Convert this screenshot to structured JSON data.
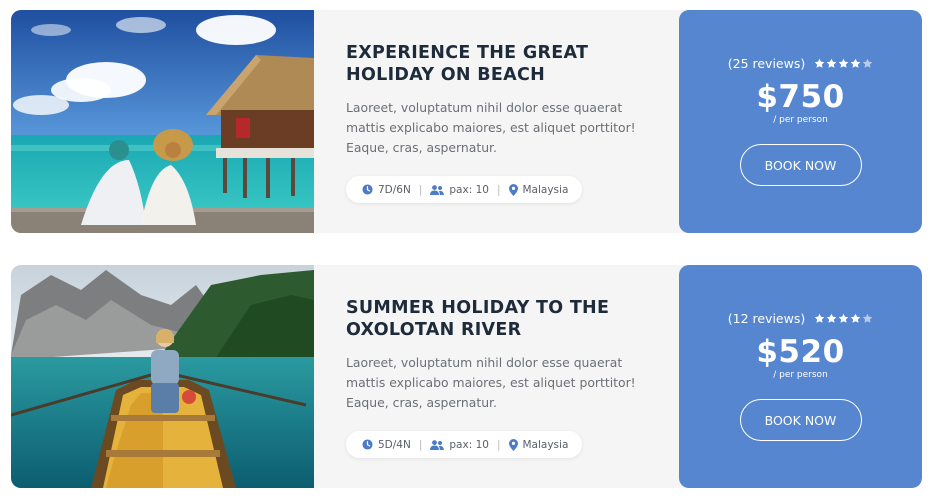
{
  "tours": [
    {
      "title": "EXPERIENCE THE GREAT HOLIDAY ON BEACH",
      "description": "Laoreet, voluptatum nihil dolor esse quaerat mattis explicabo maiores, est aliquet porttitor! Eaque, cras, aspernatur.",
      "duration": "7D/6N",
      "pax": "pax: 10",
      "location": "Malaysia",
      "reviews": "(25 reviews)",
      "rating": 4,
      "price": "$750",
      "per": "/ per person",
      "button": "BOOK NOW",
      "image": "beach-overwater-bungalow-couple"
    },
    {
      "title": "SUMMER HOLIDAY TO THE OXOLOTAN RIVER",
      "description": "Laoreet, voluptatum nihil dolor esse quaerat mattis explicabo maiores, est aliquet porttitor! Eaque, cras, aspernatur.",
      "duration": "5D/4N",
      "pax": "pax: 10",
      "location": "Malaysia",
      "reviews": "(12 reviews)",
      "rating": 4,
      "price": "$520",
      "per": "/ per person",
      "button": "BOOK NOW",
      "image": "mountain-lake-rowboat-woman"
    }
  ],
  "colors": {
    "accent": "#5586cf",
    "card_bg": "#f5f5f5",
    "title": "#1e2b3a",
    "text": "#6b6f75",
    "icon": "#4d7cc6",
    "star_on": "#ffffff",
    "star_off": "#b9c9e6"
  },
  "icons": {
    "duration": "clock-icon",
    "pax": "users-icon",
    "location": "map-pin-icon",
    "rating": "star-icon"
  }
}
